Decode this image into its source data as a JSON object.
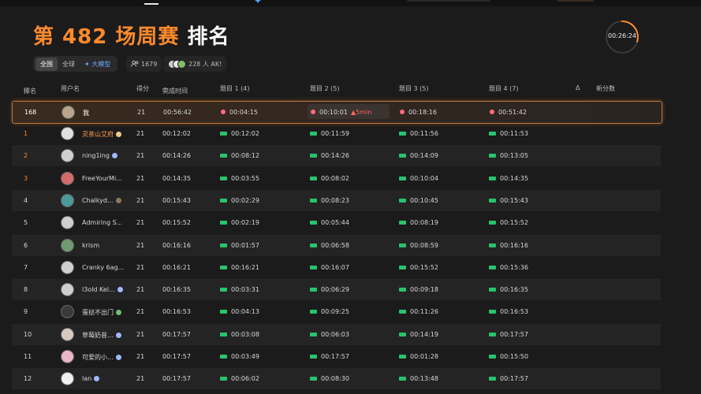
{
  "title": {
    "prefix": "第 482 场周赛",
    "suffix": "排名"
  },
  "timer": "00:26:24",
  "scope_tabs": [
    "全国",
    "全球",
    "大模型"
  ],
  "participants": "1679",
  "ak_count": "228 人 AK!",
  "headers": {
    "rank": "排名",
    "user": "用户名",
    "score": "得分",
    "finish": "完成时间",
    "q1": "题目 1 (4)",
    "q2": "题目 2 (5)",
    "q3": "题目 3 (5)",
    "q4": "题目 4 (7)",
    "delta": "Δ",
    "new_score": "新分数"
  },
  "icons": {
    "info": "info-icon",
    "users": "users-icon",
    "sparkle": "sparkle-icon",
    "ac_flag": "flag-icon",
    "wa_mark": "wrong-answer-icon"
  },
  "colors": {
    "accent": "#ff8a2b",
    "ac": "#27c46b",
    "wa": "#ff6b7a"
  },
  "me": {
    "rank": "168",
    "name": "我",
    "score": "21",
    "finish": "00:56:42",
    "q1": "00:04:15",
    "q2": "00:10:01",
    "q2_penalty": "5min",
    "q3": "00:18:16",
    "q4": "00:51:42"
  },
  "rows": [
    {
      "rank": "1",
      "name": "灵茶山艾府",
      "score": "21",
      "finish": "00:12:02",
      "q1": "00:12:02",
      "q2": "00:11:59",
      "q3": "00:11:56",
      "q4": "00:11:53"
    },
    {
      "rank": "2",
      "name": "ning1ing",
      "score": "21",
      "finish": "00:14:26",
      "q1": "00:08:12",
      "q2": "00:14:26",
      "q3": "00:14:09",
      "q4": "00:13:05"
    },
    {
      "rank": "3",
      "name": "FreeYourMi...",
      "score": "21",
      "finish": "00:14:35",
      "q1": "00:03:55",
      "q2": "00:08:02",
      "q3": "00:10:04",
      "q4": "00:14:35"
    },
    {
      "rank": "4",
      "name": "Chalkyd...",
      "score": "21",
      "finish": "00:15:43",
      "q1": "00:02:29",
      "q2": "00:08:23",
      "q3": "00:10:45",
      "q4": "00:15:43"
    },
    {
      "rank": "5",
      "name": "Admiring S...",
      "score": "21",
      "finish": "00:15:52",
      "q1": "00:02:19",
      "q2": "00:05:44",
      "q3": "00:08:19",
      "q4": "00:15:52"
    },
    {
      "rank": "6",
      "name": "krism",
      "score": "21",
      "finish": "00:16:16",
      "q1": "00:01:57",
      "q2": "00:06:58",
      "q3": "00:08:59",
      "q4": "00:16:16"
    },
    {
      "rank": "7",
      "name": "Cranky 6ag...",
      "score": "21",
      "finish": "00:16:21",
      "q1": "00:16:21",
      "q2": "00:16:07",
      "q3": "00:15:52",
      "q4": "00:15:36"
    },
    {
      "rank": "8",
      "name": "l3old Kel...",
      "score": "21",
      "finish": "00:16:35",
      "q1": "00:03:31",
      "q2": "00:06:29",
      "q3": "00:09:18",
      "q4": "00:16:35"
    },
    {
      "rank": "9",
      "name": "蛋挞不出门",
      "score": "21",
      "finish": "00:16:53",
      "q1": "00:04:13",
      "q2": "00:09:25",
      "q3": "00:11:26",
      "q4": "00:16:53"
    },
    {
      "rank": "10",
      "name": "草莓奶昔...",
      "score": "21",
      "finish": "00:17:57",
      "q1": "00:03:08",
      "q2": "00:06:03",
      "q3": "00:14:19",
      "q4": "00:17:57"
    },
    {
      "rank": "11",
      "name": "可爱的小...",
      "score": "21",
      "finish": "00:17:57",
      "q1": "00:03:49",
      "q2": "00:17:57",
      "q3": "00:01:28",
      "q4": "00:15:50"
    },
    {
      "rank": "12",
      "name": "lan",
      "score": "21",
      "finish": "00:17:57",
      "q1": "00:06:02",
      "q2": "00:08:30",
      "q3": "00:13:48",
      "q4": "00:17:57"
    }
  ]
}
